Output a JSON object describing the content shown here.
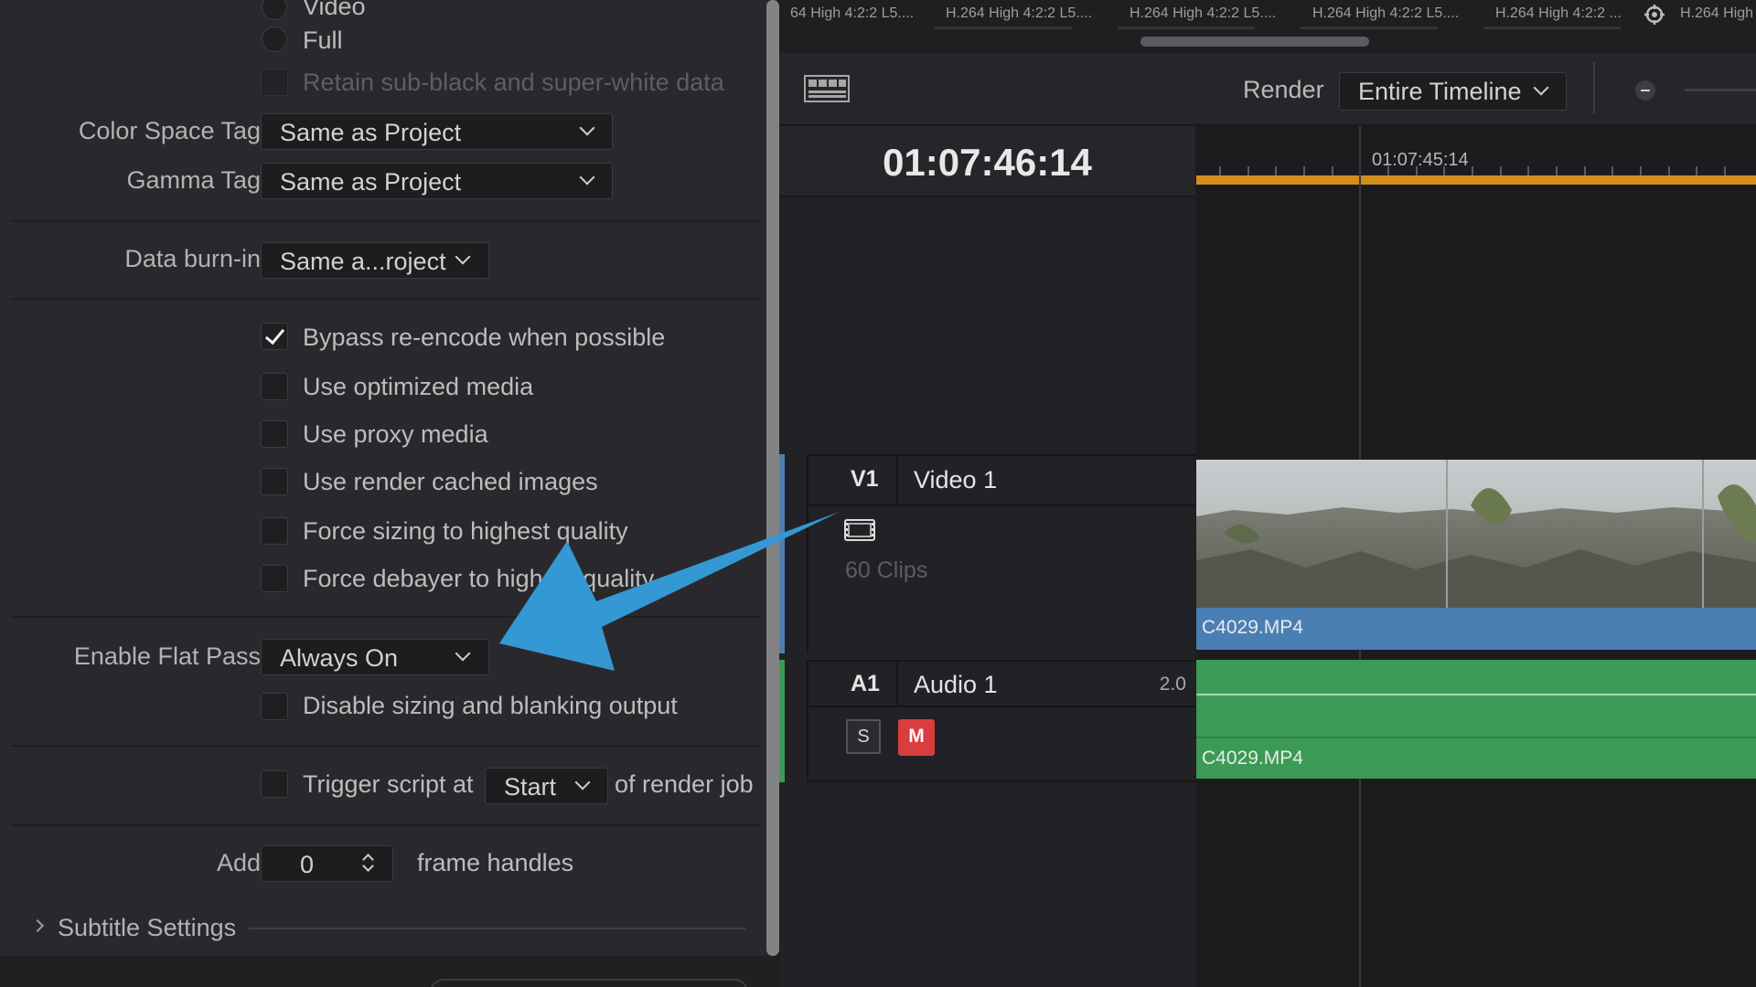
{
  "settings": {
    "radio_video": "Video",
    "radio_full": "Full",
    "retain_label": "Retain sub-black and super-white data",
    "color_space_label": "Color Space Tag",
    "color_space_value": "Same as Project",
    "gamma_label": "Gamma Tag",
    "gamma_value": "Same as Project",
    "burnin_label": "Data burn-in",
    "burnin_value": "Same a...roject",
    "checkboxes": [
      {
        "label": "Bypass re-encode when possible",
        "checked": true
      },
      {
        "label": "Use optimized media",
        "checked": false
      },
      {
        "label": "Use proxy media",
        "checked": false
      },
      {
        "label": "Use render cached images",
        "checked": false
      },
      {
        "label": "Force sizing to highest quality",
        "checked": false
      },
      {
        "label": "Force debayer to highest quality",
        "checked": false
      }
    ],
    "flat_pass_label": "Enable Flat Pass",
    "flat_pass_value": "Always On",
    "disable_sizing_label": "Disable sizing and blanking output",
    "trigger_label": "Trigger script at",
    "trigger_value": "Start",
    "trigger_suffix": "of render job",
    "add_label": "Add",
    "add_value": "0",
    "add_suffix": "frame handles",
    "subtitle_label": "Subtitle Settings"
  },
  "queue_strip": {
    "items": [
      "64 High 4:2:2 L5....",
      "H.264 High 4:2:2 L5....",
      "H.264 High 4:2:2 L5....",
      "H.264 High 4:2:2 L5....",
      "H.264 High 4:2:2 ...",
      "H.264 High"
    ]
  },
  "toolbar": {
    "render_label": "Render",
    "render_value": "Entire Timeline"
  },
  "timeline": {
    "timecode": "01:07:46:14",
    "ruler_timecode": "01:07:45:14",
    "video_track": {
      "id": "V1",
      "name": "Video 1",
      "clips": "60 Clips",
      "clip_name": "C4029.MP4"
    },
    "audio_track": {
      "id": "A1",
      "name": "Audio 1",
      "channels": "2.0",
      "solo": "S",
      "mute": "M",
      "clip_name": "C4029.MP4"
    }
  },
  "colors": {
    "accent_orange": "#d18e1e",
    "video_clip_blue": "#4a7fb4",
    "audio_clip_green": "#3b9a55",
    "mute_red": "#d93d3d",
    "annotation_arrow": "#3498d4"
  }
}
